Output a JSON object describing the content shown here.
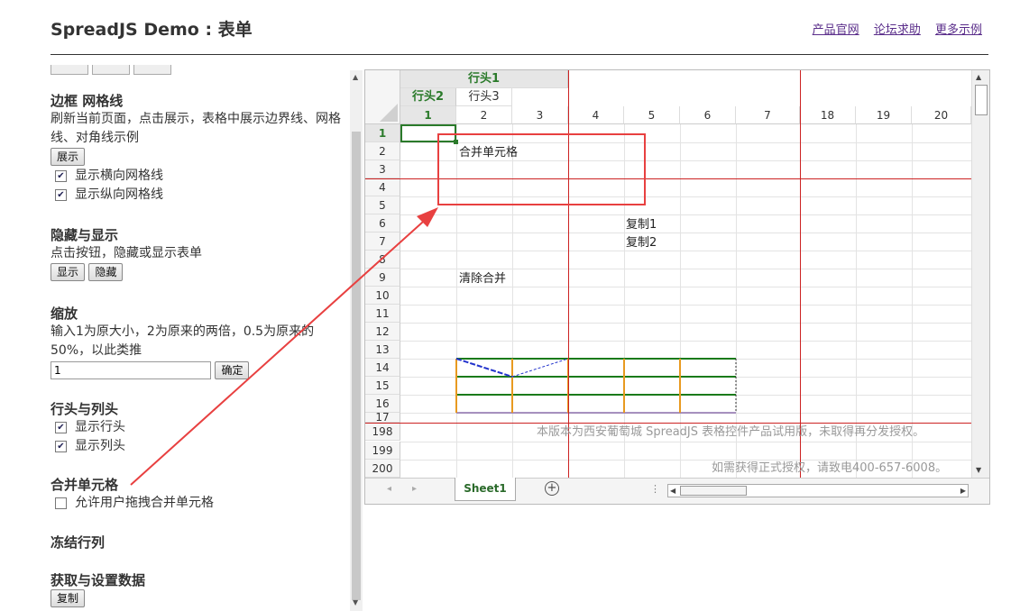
{
  "header": {
    "title": "SpreadJS Demo : 表单",
    "links": [
      "产品官网",
      "论坛求助",
      "更多示例"
    ]
  },
  "sections": {
    "border": {
      "title": "边框 网格线",
      "desc": "刷新当前页面，点击展示，表格中展示边界线、网格线、对角线示例",
      "button": "展示",
      "checks": [
        {
          "label": "显示横向网格线",
          "checked": true
        },
        {
          "label": "显示纵向网格线",
          "checked": true
        }
      ]
    },
    "hide": {
      "title": "隐藏与显示",
      "desc": "点击按钮，隐藏或显示表单",
      "buttons": [
        "显示",
        "隐藏"
      ]
    },
    "zoom": {
      "title": "缩放",
      "desc": "输入1为原大小，2为原来的两倍，0.5为原来的50%，以此类推",
      "input_value": "1",
      "button": "确定"
    },
    "headers": {
      "title": "行头与列头",
      "checks": [
        {
          "label": "显示行头",
          "checked": true
        },
        {
          "label": "显示列头",
          "checked": true
        }
      ]
    },
    "merge": {
      "title": "合并单元格",
      "checks": [
        {
          "label": "允许用户拖拽合并单元格",
          "checked": false
        }
      ]
    },
    "freeze": {
      "title": "冻结行列"
    },
    "data": {
      "title": "获取与设置数据",
      "button": "复制"
    }
  },
  "sheet": {
    "col_header_top": "行头1",
    "col_header_mid_left": "行头2",
    "col_header_mid": "行头3",
    "columns": [
      "1",
      "2",
      "3",
      "4",
      "5",
      "6",
      "7",
      "18",
      "19",
      "20"
    ],
    "rows": [
      "1",
      "2",
      "3",
      "4",
      "5",
      "6",
      "7",
      "8",
      "9",
      "10",
      "11",
      "12",
      "13",
      "14",
      "15",
      "16",
      "17",
      "198",
      "199",
      "200"
    ],
    "cells": {
      "merge_text": "合并单元格",
      "copy1": "复制1",
      "copy2": "复制2",
      "clear_merge": "清除合并"
    },
    "watermark1": "本版本为西安葡萄城 SpreadJS 表格控件产品试用版，未取得再分发授权。",
    "watermark2": "如需获得正式授权，请致电400-657-6008。",
    "tab_name": "Sheet1",
    "accent_green": "#2a7a2a",
    "annotation_red": "#e84040"
  }
}
